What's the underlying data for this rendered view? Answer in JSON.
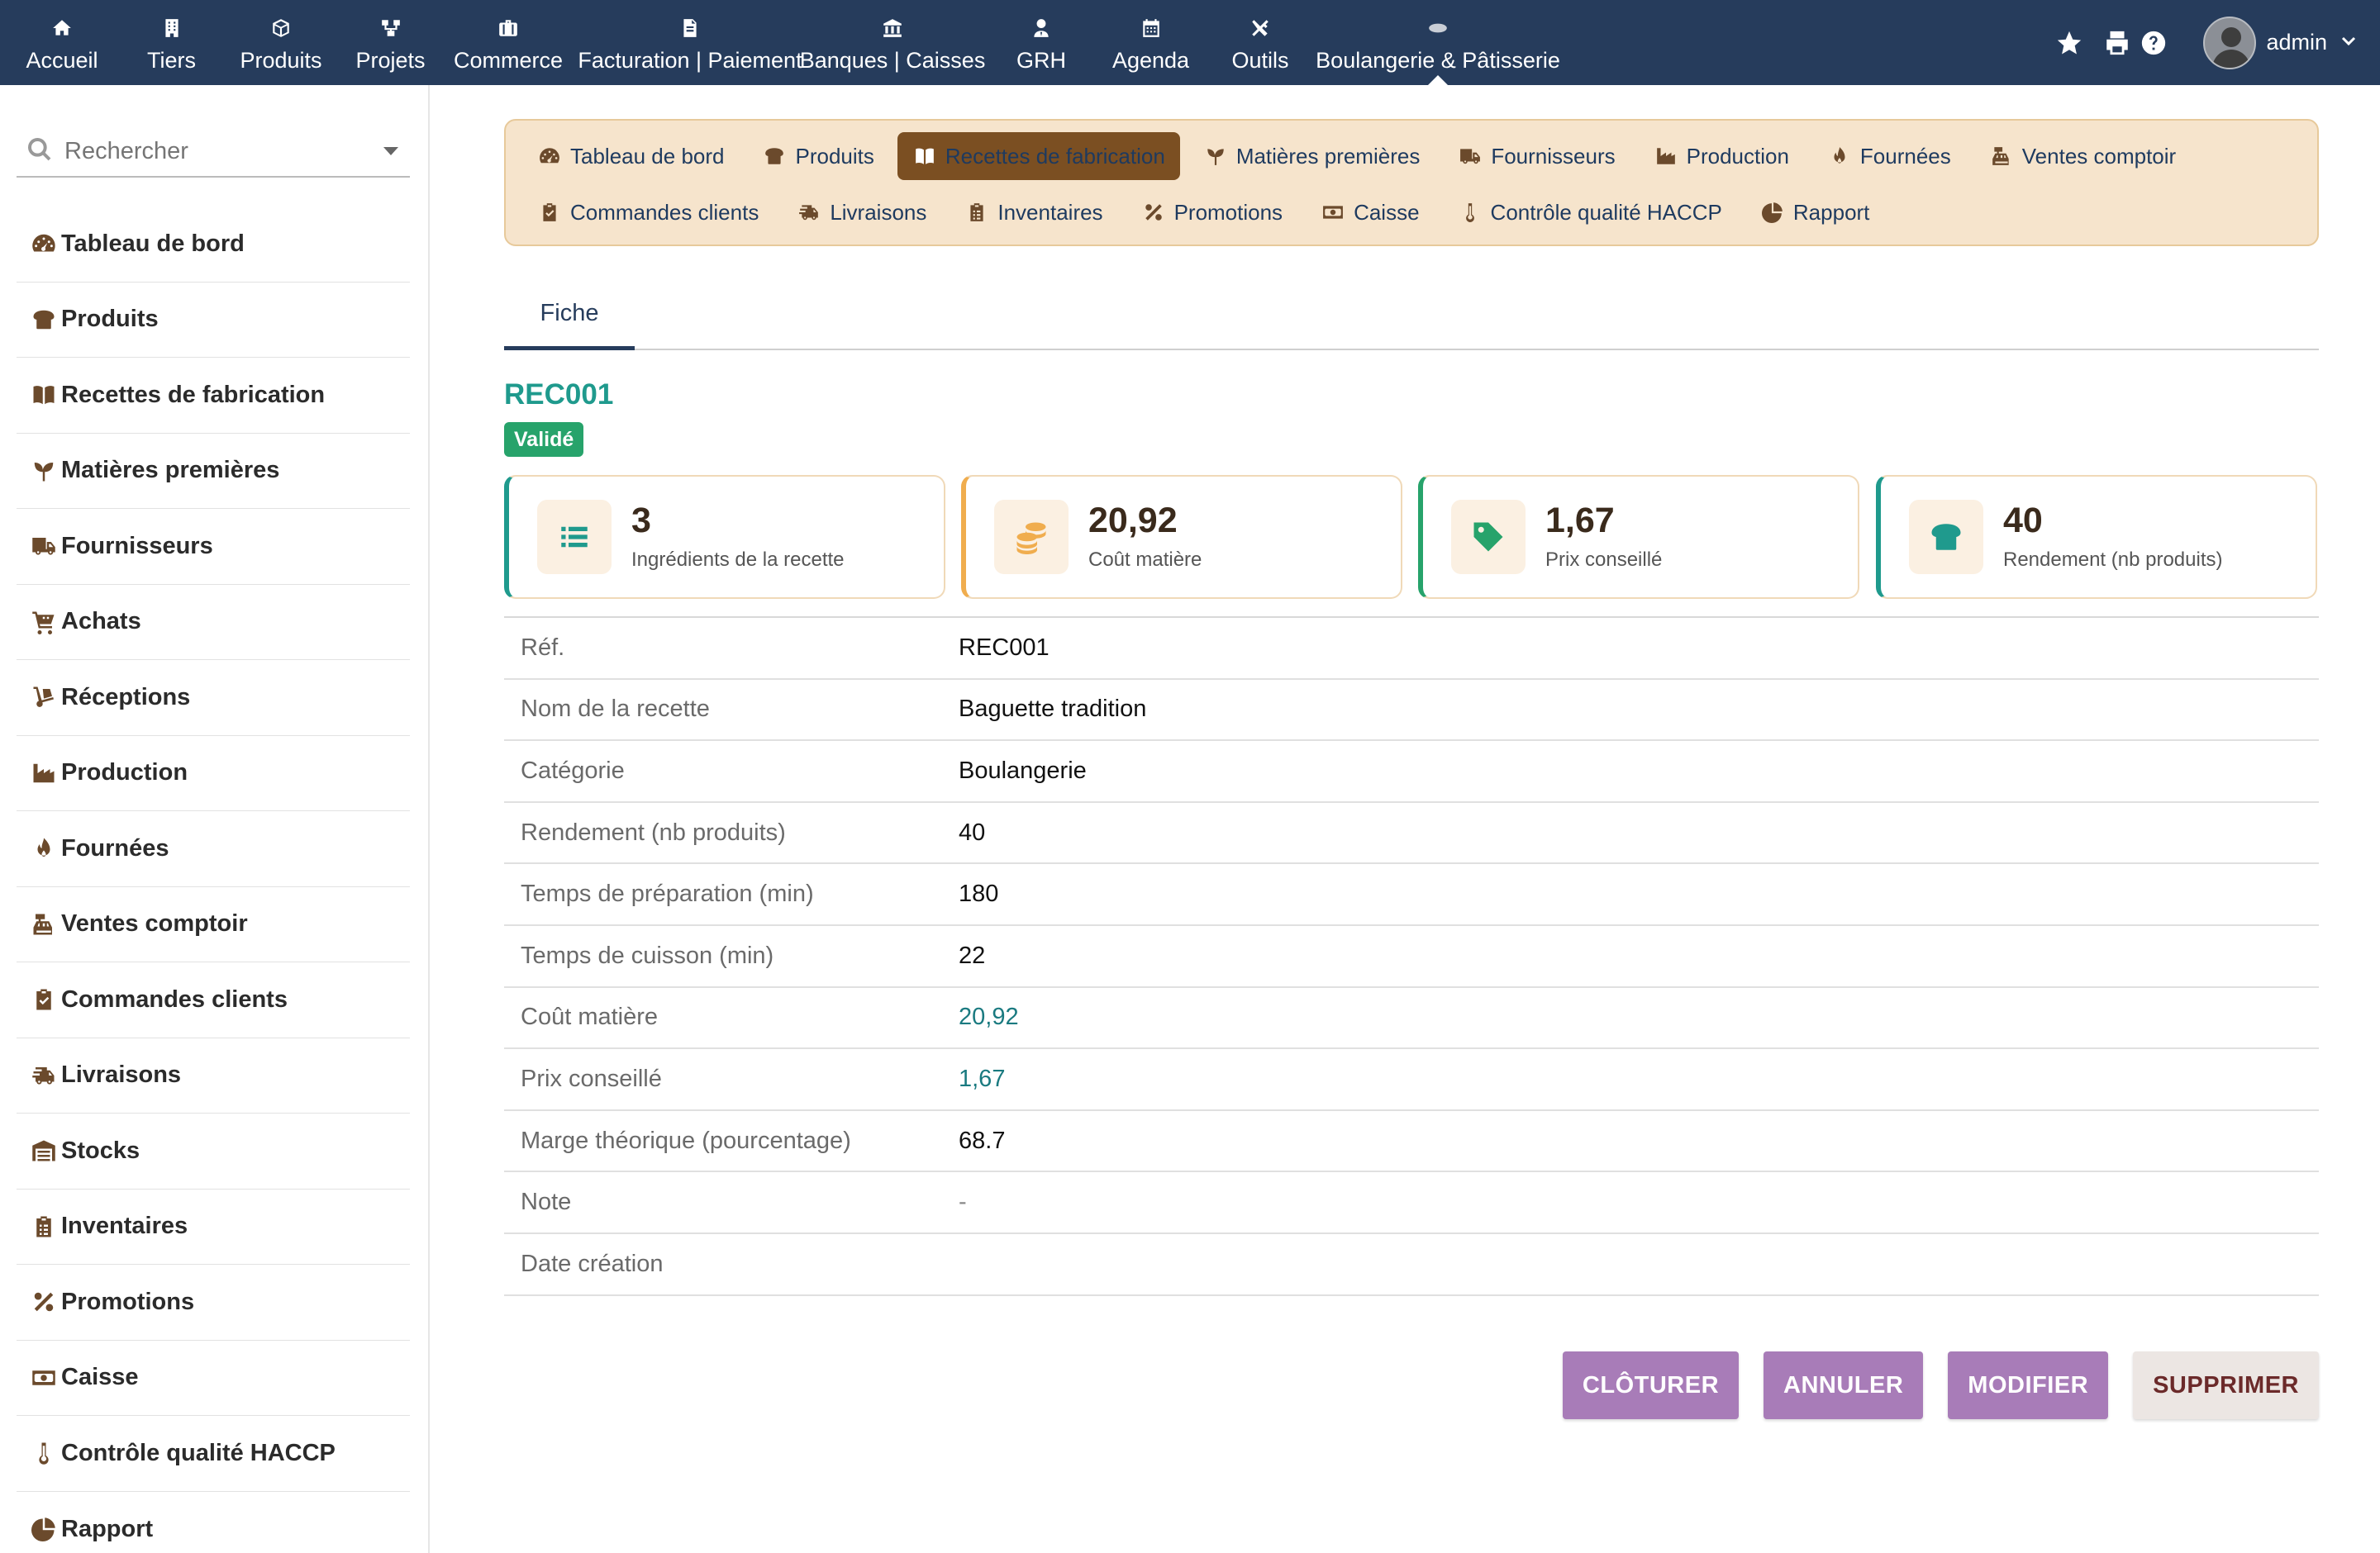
{
  "topnav": {
    "items": [
      {
        "label": "Accueil",
        "icon": "home-icon"
      },
      {
        "label": "Tiers",
        "icon": "building-icon"
      },
      {
        "label": "Produits",
        "icon": "cube-icon"
      },
      {
        "label": "Projets",
        "icon": "sitemap-icon"
      },
      {
        "label": "Commerce",
        "icon": "suitcase-icon"
      },
      {
        "label": "Facturation | Paiement",
        "icon": "invoice-icon"
      },
      {
        "label": "Banques | Caisses",
        "icon": "bank-icon"
      },
      {
        "label": "GRH",
        "icon": "user-tie-icon"
      },
      {
        "label": "Agenda",
        "icon": "calendar-icon"
      },
      {
        "label": "Outils",
        "icon": "tools-icon"
      },
      {
        "label": "Boulangerie & Pâtisserie",
        "icon": "bread-icon",
        "active": true
      }
    ],
    "username": "admin"
  },
  "sidebar": {
    "search_placeholder": "Rechercher",
    "items": [
      {
        "label": "Tableau de bord",
        "icon": "dashboard-icon"
      },
      {
        "label": "Produits",
        "icon": "bread-icon"
      },
      {
        "label": "Recettes de fabrication",
        "icon": "book-icon"
      },
      {
        "label": "Matières premières",
        "icon": "seedling-icon"
      },
      {
        "label": "Fournisseurs",
        "icon": "truck-icon"
      },
      {
        "label": "Achats",
        "icon": "cart-icon"
      },
      {
        "label": "Réceptions",
        "icon": "dolly-icon"
      },
      {
        "label": "Production",
        "icon": "industry-icon"
      },
      {
        "label": "Fournées",
        "icon": "fire-icon"
      },
      {
        "label": "Ventes comptoir",
        "icon": "cash-register-icon"
      },
      {
        "label": "Commandes clients",
        "icon": "clipboard-check-icon"
      },
      {
        "label": "Livraisons",
        "icon": "shipping-fast-icon"
      },
      {
        "label": "Stocks",
        "icon": "warehouse-icon"
      },
      {
        "label": "Inventaires",
        "icon": "clipboard-list-icon"
      },
      {
        "label": "Promotions",
        "icon": "percent-icon"
      },
      {
        "label": "Caisse",
        "icon": "money-bill-icon"
      },
      {
        "label": "Contrôle qualité HACCP",
        "icon": "thermometer-icon"
      },
      {
        "label": "Rapport",
        "icon": "pie-chart-icon"
      }
    ]
  },
  "modules": {
    "row1": [
      {
        "label": "Tableau de bord",
        "icon": "dashboard-icon"
      },
      {
        "label": "Produits",
        "icon": "bread-icon"
      },
      {
        "label": "Recettes de fabrication",
        "icon": "book-icon",
        "active": true
      },
      {
        "label": "Matières premières",
        "icon": "seedling-icon"
      },
      {
        "label": "Fournisseurs",
        "icon": "truck-icon"
      },
      {
        "label": "Production",
        "icon": "industry-icon"
      },
      {
        "label": "Fournées",
        "icon": "fire-icon"
      },
      {
        "label": "Ventes comptoir",
        "icon": "cash-register-icon"
      }
    ],
    "row2": [
      {
        "label": "Commandes clients",
        "icon": "clipboard-check-icon"
      },
      {
        "label": "Livraisons",
        "icon": "shipping-fast-icon"
      },
      {
        "label": "Inventaires",
        "icon": "clipboard-list-icon"
      },
      {
        "label": "Promotions",
        "icon": "percent-icon"
      },
      {
        "label": "Caisse",
        "icon": "money-bill-icon"
      },
      {
        "label": "Contrôle qualité HACCP",
        "icon": "thermometer-icon"
      },
      {
        "label": "Rapport",
        "icon": "pie-chart-icon"
      }
    ]
  },
  "tabs": {
    "fiche": "Fiche"
  },
  "record": {
    "ref": "REC001",
    "status": "Validé"
  },
  "cards": [
    {
      "value": "3",
      "label": "Ingrédients de la recette",
      "icon": "list-icon",
      "accent": "#1f9a8d"
    },
    {
      "value": "20,92",
      "label": "Coût matière",
      "icon": "coins-icon",
      "accent": "#f0ad4e"
    },
    {
      "value": "1,67",
      "label": "Prix conseillé",
      "icon": "tag-icon",
      "accent": "#27a36b"
    },
    {
      "value": "40",
      "label": "Rendement (nb produits)",
      "icon": "bread-icon",
      "accent": "#1f9a8d"
    }
  ],
  "details": [
    {
      "label": "Réf.",
      "value": "REC001"
    },
    {
      "label": "Nom de la recette",
      "value": "Baguette tradition"
    },
    {
      "label": "Catégorie",
      "value": "Boulangerie"
    },
    {
      "label": "Rendement (nb produits)",
      "value": "40"
    },
    {
      "label": "Temps de préparation (min)",
      "value": "180"
    },
    {
      "label": "Temps de cuisson (min)",
      "value": "22"
    },
    {
      "label": "Coût matière",
      "value": "20,92",
      "teal": true
    },
    {
      "label": "Prix conseillé",
      "value": "1,67",
      "teal": true
    },
    {
      "label": "Marge théorique (pourcentage)",
      "value": "68.7"
    },
    {
      "label": "Note",
      "value": "-"
    },
    {
      "label": "Date création",
      "value": ""
    }
  ],
  "actions": {
    "cloturer": "CLÔTURER",
    "annuler": "ANNULER",
    "modifier": "MODIFIER",
    "supprimer": "SUPPRIMER"
  }
}
